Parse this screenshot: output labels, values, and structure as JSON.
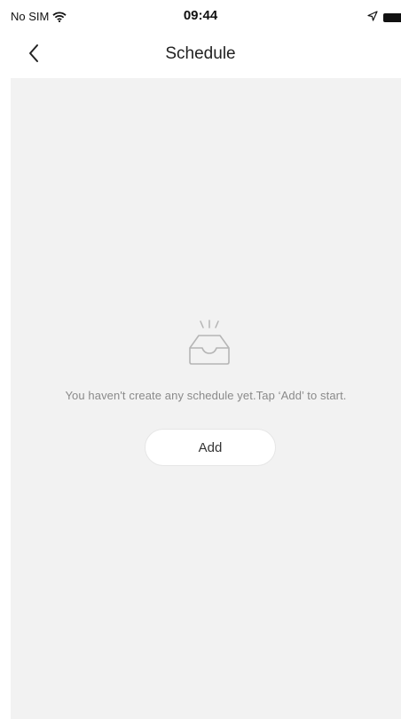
{
  "status_bar": {
    "carrier": "No SIM",
    "time": "09:44",
    "icons": [
      "wifi-icon",
      "location-arrow-icon",
      "battery-icon"
    ]
  },
  "nav": {
    "back_icon": "chevron-left-icon",
    "title": "Schedule"
  },
  "empty_state": {
    "icon": "empty-inbox-icon",
    "message": "You haven't create any schedule yet.Tap ‘Add’ to start.",
    "add_label": "Add"
  },
  "colors": {
    "background": "#f2f2f2",
    "surface": "#ffffff",
    "muted_text": "#8a8a8a",
    "primary_text": "#222222"
  }
}
